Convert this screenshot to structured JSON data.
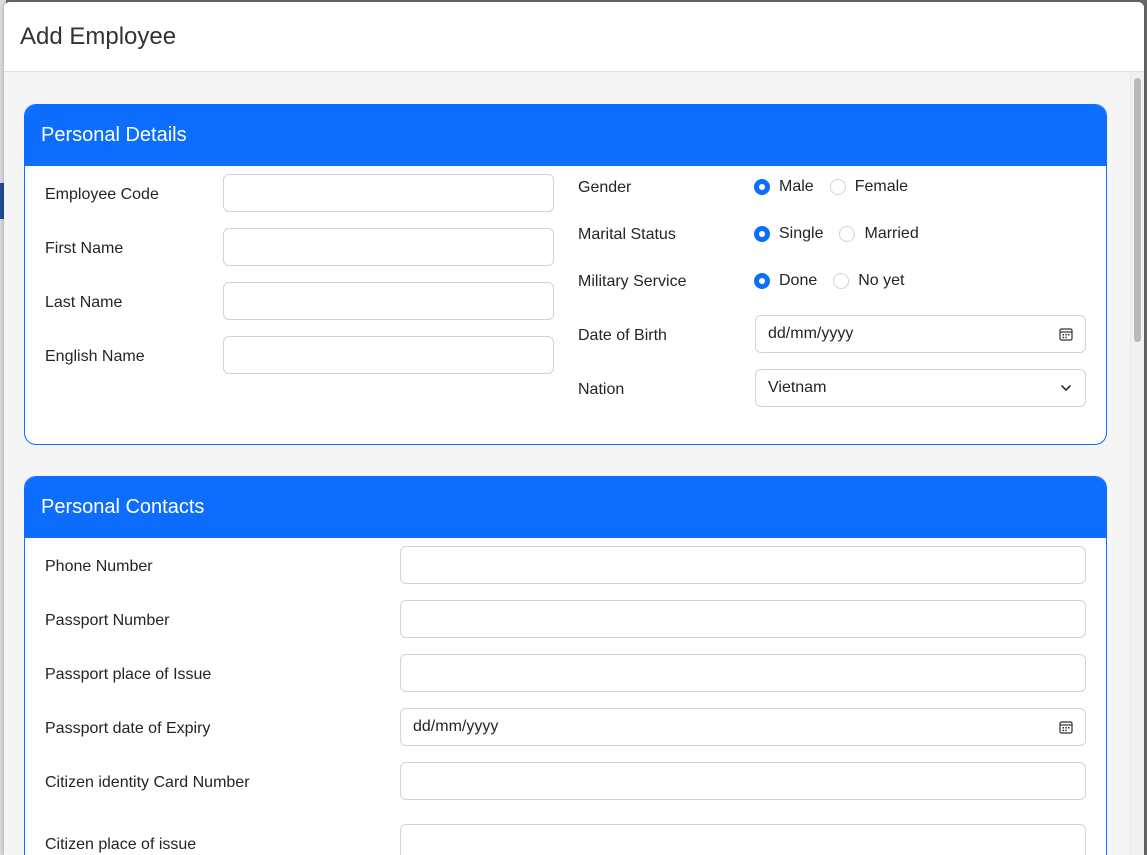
{
  "modal": {
    "title": "Add Employee"
  },
  "personal_details": {
    "header": "Personal Details",
    "employee_code_label": "Employee Code",
    "employee_code_value": "",
    "first_name_label": "First Name",
    "first_name_value": "",
    "last_name_label": "Last Name",
    "last_name_value": "",
    "english_name_label": "English Name",
    "english_name_value": "",
    "gender_label": "Gender",
    "gender_options": [
      "Male",
      "Female"
    ],
    "gender_selected": "Male",
    "marital_status_label": "Marital Status",
    "marital_options": [
      "Single",
      "Married"
    ],
    "marital_selected": "Single",
    "military_service_label": "Military Service",
    "military_options": [
      "Done",
      "No yet"
    ],
    "military_selected": "Done",
    "dob_label": "Date of Birth",
    "dob_placeholder": "dd/mm/yyyy",
    "nation_label": "Nation",
    "nation_value": "Vietnam"
  },
  "personal_contacts": {
    "header": "Personal Contacts",
    "phone_label": "Phone Number",
    "passport_number_label": "Passport Number",
    "passport_place_label": "Passport place of Issue",
    "passport_expiry_label": "Passport date of Expiry",
    "passport_expiry_placeholder": "dd/mm/yyyy",
    "citizen_id_label": "Citizen identity Card Number",
    "citizen_place_label": "Citizen place of issue"
  },
  "icons": {
    "calendar": "calendar-icon",
    "dropdown": "chevron-down-icon"
  },
  "colors": {
    "accent": "#0d6efd",
    "input_border": "#ced4da",
    "body_bg": "#f5f5f5"
  }
}
